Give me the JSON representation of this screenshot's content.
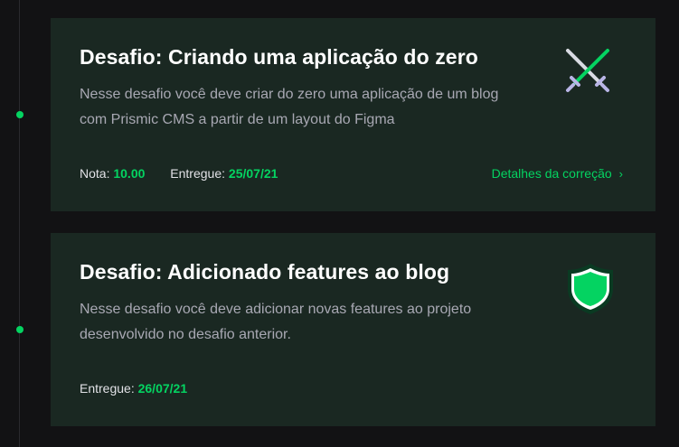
{
  "challenges": [
    {
      "title": "Desafio: Criando uma aplicação do zero",
      "description": "Nesse desafio você deve criar do zero uma aplicação de um blog com Prismic CMS a partir de um layout do Figma",
      "grade_label": "Nota:",
      "grade_value": "10.00",
      "delivered_label": "Entregue:",
      "delivered_value": "25/07/21",
      "details_link": "Detalhes da correção",
      "icon": "crossed-swords-icon"
    },
    {
      "title": "Desafio: Adicionado features ao blog",
      "description": "Nesse desafio você deve adicionar novas features ao projeto desenvolvido no desafio anterior.",
      "delivered_label": "Entregue:",
      "delivered_value": "26/07/21",
      "icon": "shield-icon"
    }
  ],
  "colors": {
    "background": "#121214",
    "card": "#1a2822",
    "accent": "#04d361",
    "muted_text": "#a8a8b3"
  }
}
